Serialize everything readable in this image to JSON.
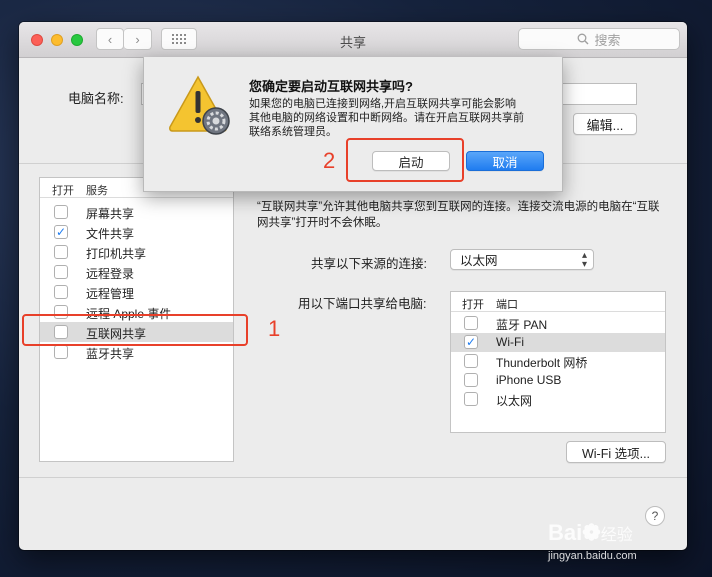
{
  "window": {
    "title": "共享",
    "search_placeholder": "搜索"
  },
  "top": {
    "computer_name_label": "电脑名称:",
    "edit_button": "编辑..."
  },
  "services": {
    "header_on": "打开",
    "header_service": "服务",
    "items": [
      {
        "label": "屏幕共享",
        "checked": false
      },
      {
        "label": "文件共享",
        "checked": true
      },
      {
        "label": "打印机共享",
        "checked": false
      },
      {
        "label": "远程登录",
        "checked": false
      },
      {
        "label": "远程管理",
        "checked": false
      },
      {
        "label": "远程 Apple 事件",
        "checked": false
      },
      {
        "label": "互联网共享",
        "checked": false,
        "selected": true
      },
      {
        "label": "蓝牙共享",
        "checked": false
      }
    ]
  },
  "detail": {
    "description": "“互联网共享”允许其他电脑共享您到互联网的连接。连接交流电源的电脑在“互联网共享”打开时不会休眠。",
    "source_label": "共享以下来源的连接:",
    "source_value": "以太网",
    "ports_label": "用以下端口共享给电脑:",
    "ports_header_on": "打开",
    "ports_header_port": "端口",
    "ports": [
      {
        "label": "蓝牙 PAN",
        "checked": false
      },
      {
        "label": "Wi-Fi",
        "checked": true,
        "selected": true
      },
      {
        "label": "Thunderbolt 网桥",
        "checked": false
      },
      {
        "label": "iPhone USB",
        "checked": false
      },
      {
        "label": "以太网",
        "checked": false
      }
    ],
    "wifi_options_button": "Wi-Fi 选项...",
    "help_button": "?"
  },
  "dialog": {
    "title": "您确定要启动互联网共享吗?",
    "message_lines": [
      "如果您的电脑已连接到网络,开启互联网共享可能会影响",
      "其他电脑的网络设置和中断网络。请在开启互联网共享前",
      "联络系统管理员。"
    ],
    "start_button": "启动",
    "cancel_button": "取消"
  },
  "annotations": {
    "step1": "1",
    "step2": "2",
    "color": "#e8402a"
  },
  "watermark": {
    "brand": "Bai",
    "brand_tail": "经验",
    "url": "jingyan.baidu.com"
  },
  "colors": {
    "accent": "#1e7cf0",
    "selection": "#dcdcdc"
  }
}
